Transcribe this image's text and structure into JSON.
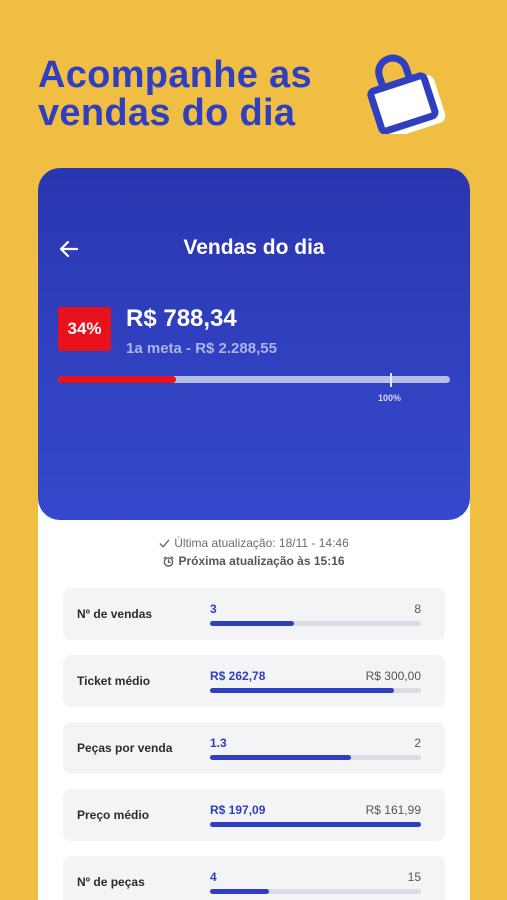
{
  "promo": {
    "title_line1": "Acompanhe as",
    "title_line2": "vendas do dia"
  },
  "header": {
    "title": "Vendas do dia",
    "percent_label": "34%",
    "amount": "R$ 788,34",
    "goal": "1a meta - R$ 2.288,55",
    "progress": 0.3,
    "goal_mark_label": "100%"
  },
  "update": {
    "last": "Última atualização: 18/11 - 14:46",
    "next": "Próxima atualização às 15:16"
  },
  "metrics": [
    {
      "label": "Nº de vendas",
      "current": "3",
      "target": "8",
      "progress": 0.4
    },
    {
      "label": "Ticket médio",
      "current": "R$ 262,78",
      "target": "R$ 300,00",
      "progress": 0.87
    },
    {
      "label": "Peças por venda",
      "current": "1.3",
      "target": "2",
      "progress": 0.67
    },
    {
      "label": "Preço médio",
      "current": "R$ 197,09",
      "target": "R$ 161,99",
      "progress": 1.0
    },
    {
      "label": "Nº de peças",
      "current": "4",
      "target": "15",
      "progress": 0.28
    }
  ],
  "colors": {
    "background": "#F1BE44",
    "brand_blue": "#2F3FBF",
    "alert_red": "#E8121C"
  },
  "icons": {
    "promo": "shopping-bag-icon",
    "back": "arrow-left-icon",
    "last_update": "check-icon",
    "next_update": "alarm-clock-icon"
  }
}
